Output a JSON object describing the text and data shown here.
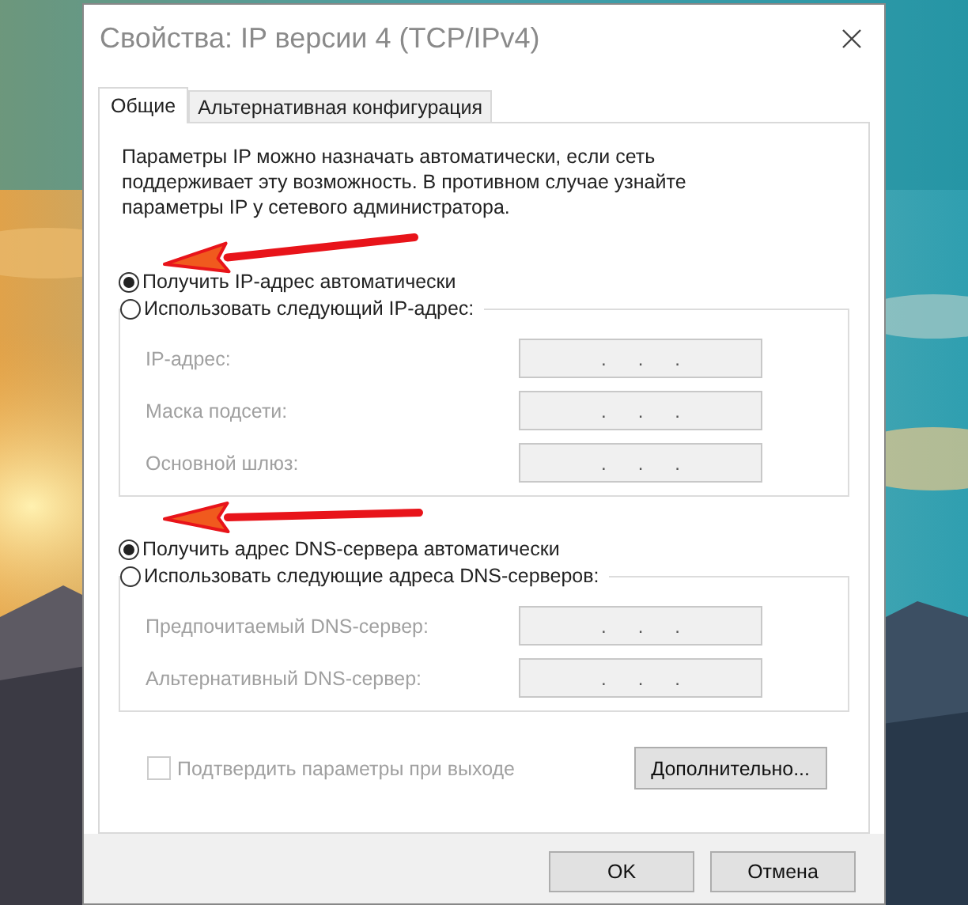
{
  "window": {
    "title": "Свойства: IP версии 4 (TCP/IPv4)"
  },
  "tabs": [
    {
      "label": "Общие",
      "selected": true
    },
    {
      "label": "Альтернативная конфигурация",
      "selected": false
    }
  ],
  "description_lines": [
    "Параметры IP можно назначать автоматически, если сеть",
    "поддерживает эту возможность. В противном случае узнайте",
    "параметры IP у сетевого администратора."
  ],
  "ip_options": [
    {
      "label": "Получить IP-адрес автоматически",
      "selected": true
    },
    {
      "label": "Использовать следующий IP-адрес:",
      "selected": false
    }
  ],
  "ip_fields": [
    {
      "label": "IP-адрес:",
      "value": ".      .      .",
      "disabled": true
    },
    {
      "label": "Маска подсети:",
      "value": ".      .      .",
      "disabled": true
    },
    {
      "label": "Основной шлюз:",
      "value": ".      .      .",
      "disabled": true
    }
  ],
  "dns_options": [
    {
      "label": "Получить адрес DNS-сервера автоматически",
      "selected": true
    },
    {
      "label": "Использовать следующие адреса DNS-серверов:",
      "selected": false
    }
  ],
  "dns_fields": [
    {
      "label": "Предпочитаемый DNS-сервер:",
      "value": ".      .      .",
      "disabled": true
    },
    {
      "label": "Альтернативный DNS-сервер:",
      "value": ".      .      .",
      "disabled": true
    }
  ],
  "confirm_checkbox": {
    "label": "Подтвердить параметры при выходе",
    "checked": false,
    "disabled": true
  },
  "advanced_button": "Дополнительно...",
  "buttons": [
    "OK",
    "Отмена"
  ]
}
